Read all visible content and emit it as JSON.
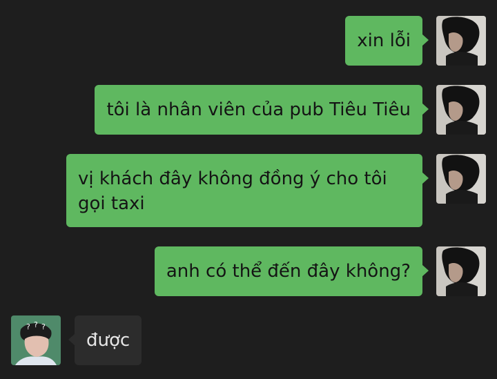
{
  "messages": [
    {
      "sender": "me",
      "text": "xin lỗi"
    },
    {
      "sender": "me",
      "text": "tôi là nhân viên của pub Tiêu Tiêu"
    },
    {
      "sender": "me",
      "text": "vị khách đây không đồng ý cho tôi gọi taxi"
    },
    {
      "sender": "me",
      "text": "anh có thể đến đây không?"
    },
    {
      "sender": "them",
      "text": "được"
    }
  ],
  "colors": {
    "background": "#1e1e1e",
    "outgoing_bubble": "#5fb860",
    "incoming_bubble": "#2c2c2c"
  },
  "icons": {
    "me_avatar": "avatar-photo-dark-hair",
    "them_avatar": "avatar-photo-question-marks"
  }
}
